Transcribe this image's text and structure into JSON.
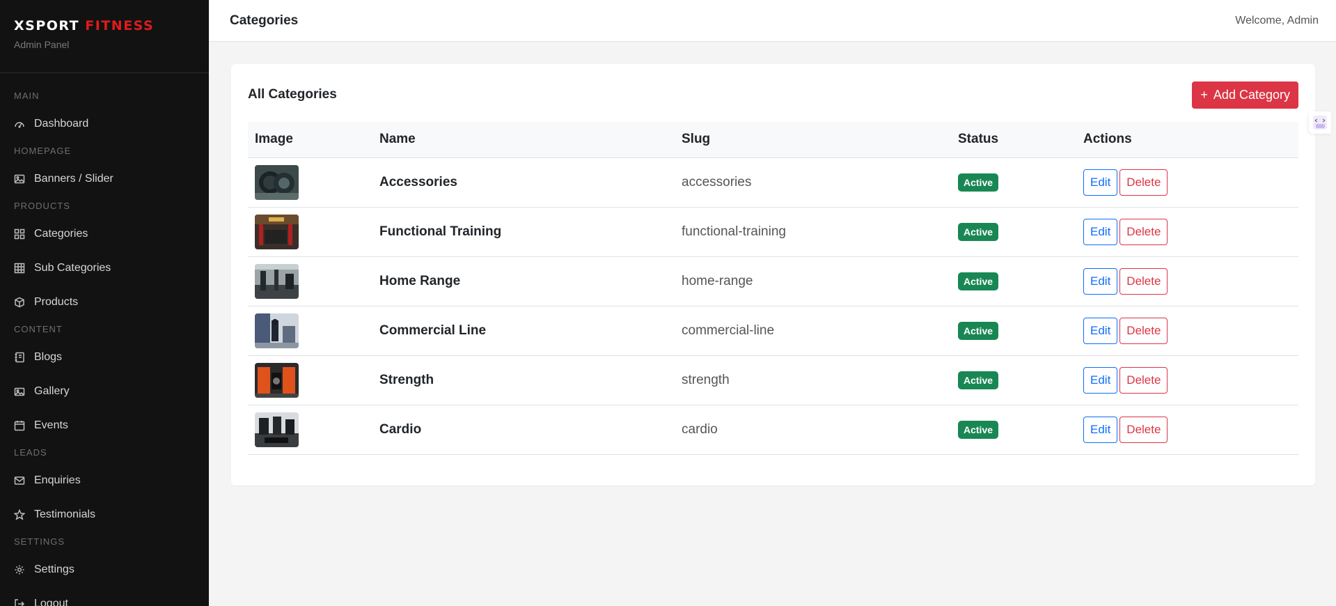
{
  "brand": {
    "name_part1": "XSPORT",
    "name_part2": "FITNESS",
    "subtitle": "Admin Panel"
  },
  "sidebar": {
    "items": [
      {
        "type": "section",
        "label": "MAIN"
      },
      {
        "type": "item",
        "label": "Dashboard",
        "icon": "speedometer-icon"
      },
      {
        "type": "section",
        "label": "HOMEPAGE"
      },
      {
        "type": "item",
        "label": "Banners / Slider",
        "icon": "image-icon"
      },
      {
        "type": "section",
        "label": "PRODUCTS"
      },
      {
        "type": "item",
        "label": "Categories",
        "icon": "grid-icon"
      },
      {
        "type": "item",
        "label": "Sub Categories",
        "icon": "table-icon"
      },
      {
        "type": "item",
        "label": "Products",
        "icon": "box-icon"
      },
      {
        "type": "section",
        "label": "CONTENT"
      },
      {
        "type": "item",
        "label": "Blogs",
        "icon": "journal-icon"
      },
      {
        "type": "item",
        "label": "Gallery",
        "icon": "images-icon"
      },
      {
        "type": "item",
        "label": "Events",
        "icon": "calendar-icon"
      },
      {
        "type": "section",
        "label": "LEADS"
      },
      {
        "type": "item",
        "label": "Enquiries",
        "icon": "envelope-icon"
      },
      {
        "type": "item",
        "label": "Testimonials",
        "icon": "star-icon"
      },
      {
        "type": "section",
        "label": "SETTINGS"
      },
      {
        "type": "item",
        "label": "Settings",
        "icon": "gear-icon"
      },
      {
        "type": "item",
        "label": "Logout",
        "icon": "logout-icon"
      }
    ]
  },
  "topbar": {
    "title": "Categories",
    "welcome": "Welcome, Admin"
  },
  "card": {
    "title": "All Categories",
    "add_label": "Add Category",
    "add_icon": "plus-icon"
  },
  "table": {
    "headers": {
      "image": "Image",
      "name": "Name",
      "slug": "Slug",
      "status": "Status",
      "actions": "Actions"
    },
    "edit_label": "Edit",
    "delete_label": "Delete",
    "rows": [
      {
        "name": "Accessories",
        "slug": "accessories",
        "status": "Active"
      },
      {
        "name": "Functional Training",
        "slug": "functional-training",
        "status": "Active"
      },
      {
        "name": "Home Range",
        "slug": "home-range",
        "status": "Active"
      },
      {
        "name": "Commercial Line",
        "slug": "commercial-line",
        "status": "Active"
      },
      {
        "name": "Strength",
        "slug": "strength",
        "status": "Active"
      },
      {
        "name": "Cardio",
        "slug": "cardio",
        "status": "Active"
      }
    ]
  },
  "colors": {
    "sidebar_bg": "#121212",
    "brand_accent": "#e01b1b",
    "primary": "#0d6efd",
    "danger": "#dc3545",
    "success": "#198754"
  }
}
